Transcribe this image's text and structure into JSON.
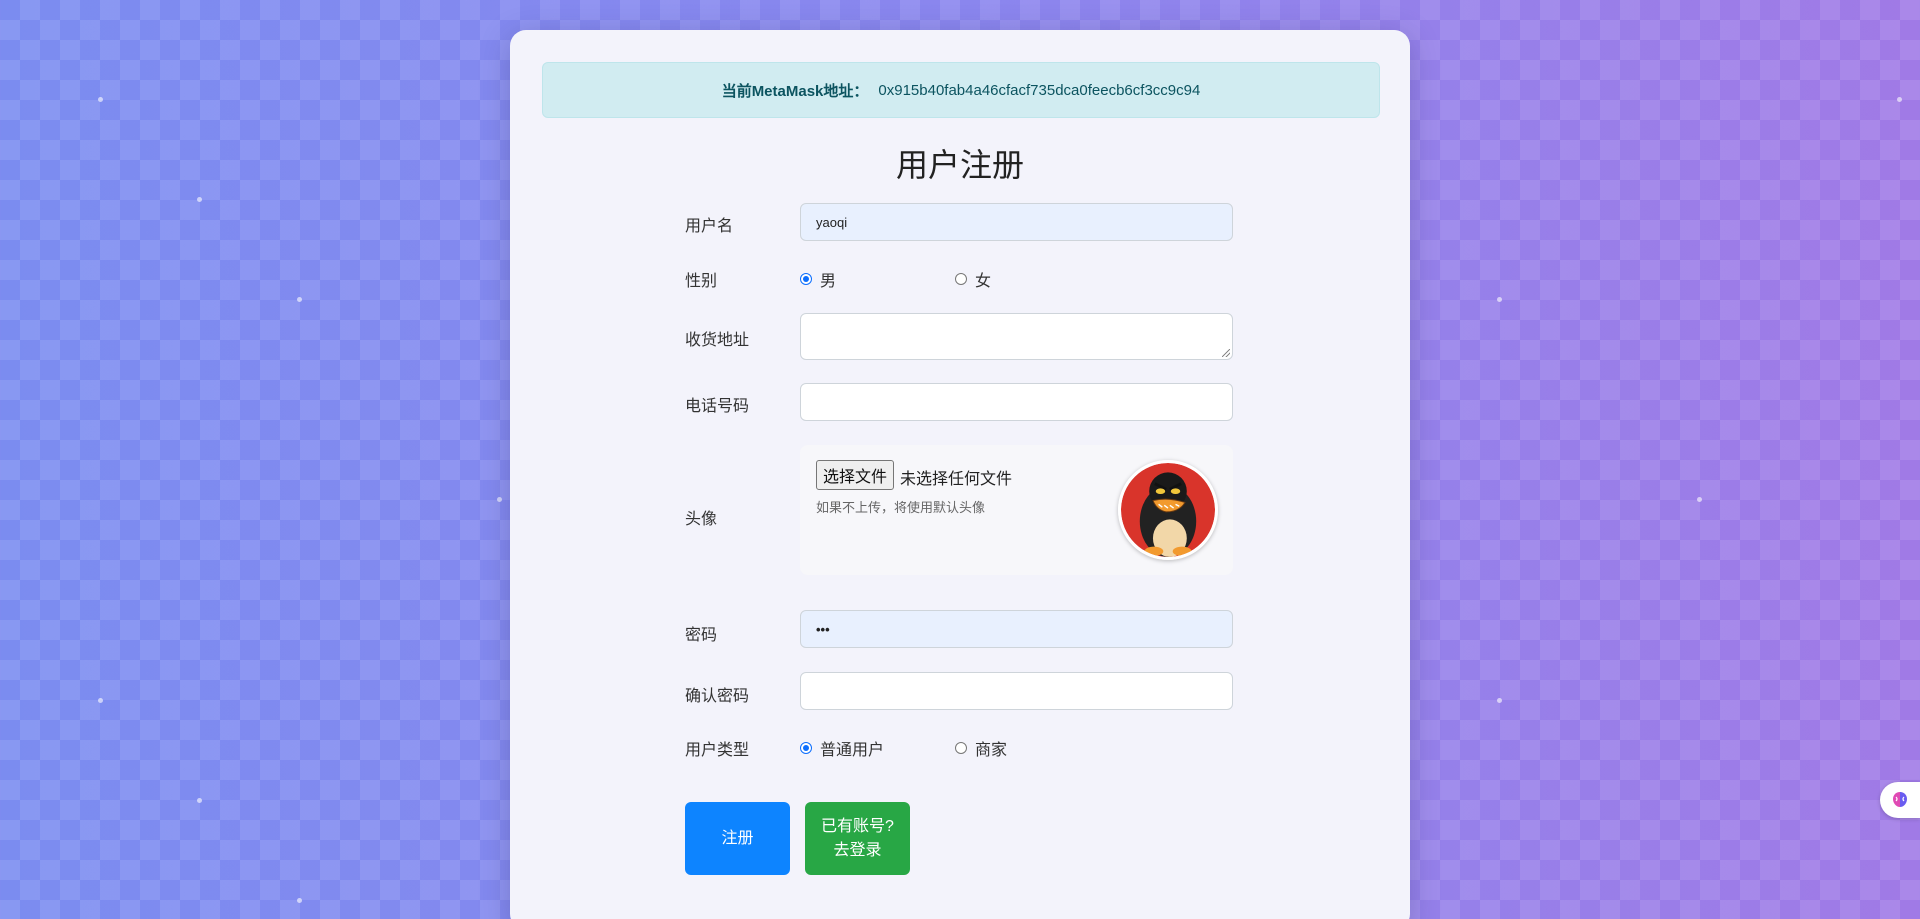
{
  "header": {
    "address_label": "当前MetaMask地址：",
    "address_value": "0x915b40fab4a46cfacf735dca0feecb6cf3cc9c94"
  },
  "page_title": "用户注册",
  "form": {
    "username": {
      "label": "用户名",
      "value": "yaoqi"
    },
    "gender": {
      "label": "性别",
      "options": [
        "男",
        "女"
      ],
      "selected": "男"
    },
    "address": {
      "label": "收货地址",
      "value": ""
    },
    "phone": {
      "label": "电话号码",
      "value": ""
    },
    "avatar": {
      "label": "头像",
      "file_button": "选择文件",
      "file_status": "未选择任何文件",
      "hint": "如果不上传，将使用默认头像",
      "image_icon": "qq-penguin-avatar"
    },
    "password": {
      "label": "密码",
      "value": "•••"
    },
    "confirm_password": {
      "label": "确认密码",
      "value": ""
    },
    "user_type": {
      "label": "用户类型",
      "options": [
        "普通用户",
        "商家"
      ],
      "selected": "普通用户"
    }
  },
  "buttons": {
    "register": "注册",
    "login_line1": "已有账号?",
    "login_line2": "去登录"
  },
  "colors": {
    "primary": "#0d84ff",
    "success": "#28a745",
    "alert_bg": "#d1ecf1",
    "alert_text": "#0c5460"
  },
  "side_widget_icon": "brain-icon"
}
